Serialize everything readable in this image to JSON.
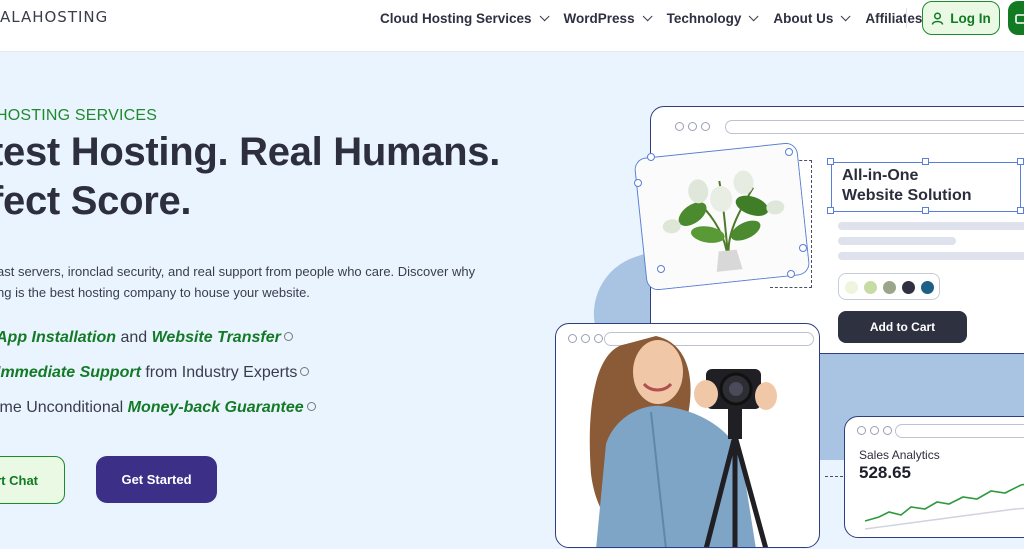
{
  "header": {
    "logo_text": "ALAHOSTING",
    "nav": [
      {
        "label": "Cloud Hosting Services",
        "dropdown": true
      },
      {
        "label": "WordPress",
        "dropdown": true
      },
      {
        "label": "Technology",
        "dropdown": true
      },
      {
        "label": "About Us",
        "dropdown": true
      },
      {
        "label": "Affiliates",
        "dropdown": false
      }
    ],
    "login_label": "Log In"
  },
  "hero": {
    "eyebrow": "HOSTING SERVICES",
    "headline_line1": "test Hosting. Real Humans.",
    "headline_line2": "fect Score.",
    "description_line1": "ast servers, ironclad security, and real support from people who care. Discover why",
    "description_line2": "ng is the best hosting company to house your website.",
    "features": [
      {
        "prefix": "",
        "strong": "App Installation",
        "middle": " and ",
        "strong2": "Website Transfer",
        "suffix": ""
      },
      {
        "prefix": "",
        "strong": "Immediate Support",
        "middle": " from Industry Experts",
        "strong2": "",
        "suffix": ""
      },
      {
        "prefix": "ime Unconditional ",
        "strong": "Money-back Guarantee",
        "middle": "",
        "strong2": "",
        "suffix": ""
      }
    ],
    "chat_button": "rt Chat",
    "start_button": "Get Started"
  },
  "illustration": {
    "aio_line1": "All-in-One",
    "aio_line2": "Website Solution",
    "add_to_cart": "Add to Cart",
    "swatch_colors": [
      "#eef5dc",
      "#c9dba4",
      "#9aa68a",
      "#2f3140",
      "#1d5f86"
    ],
    "analytics_title": "Sales Analytics",
    "analytics_value": "528.65"
  },
  "colors": {
    "brand_green": "#117a23",
    "brand_purple": "#3b2f87",
    "hero_bg": "#eaf4ff"
  }
}
